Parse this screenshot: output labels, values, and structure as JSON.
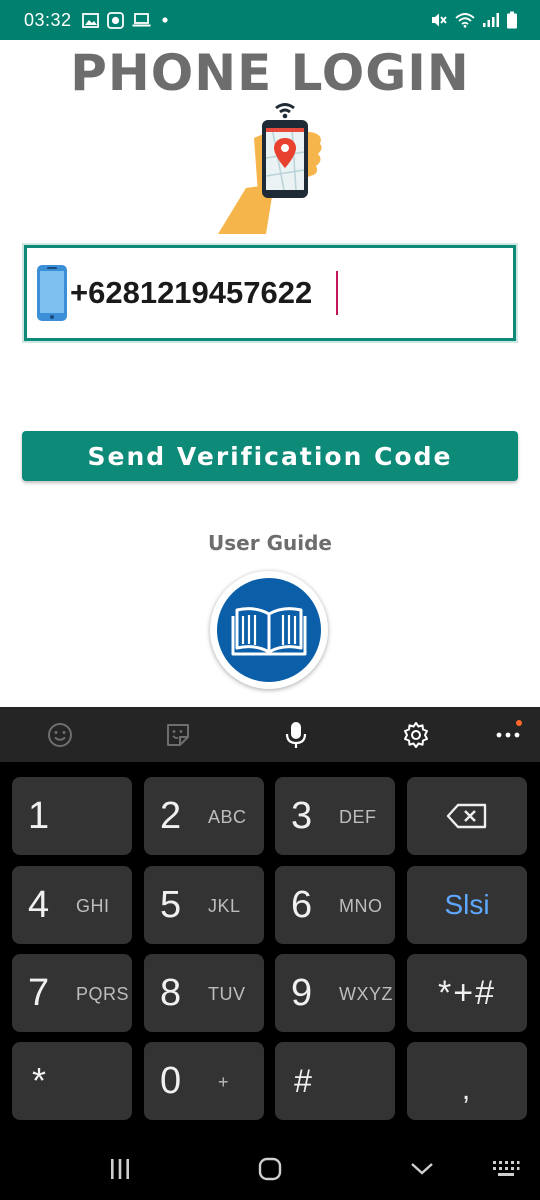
{
  "status_bar": {
    "time": "03:32",
    "left_icons": [
      "image-icon",
      "record-icon",
      "laptop-icon",
      "dot-icon"
    ],
    "right_icons": [
      "mute-icon",
      "wifi-icon",
      "signal-icon",
      "battery-icon"
    ]
  },
  "app": {
    "title": "PHONE LOGIN",
    "hero_icon": "phone-location-hand-icon"
  },
  "phone_field": {
    "value": "+6281219457622",
    "icon": "phone-icon"
  },
  "send_button": {
    "label": "Send Verification Code"
  },
  "user_guide": {
    "label": "User Guide",
    "icon": "book-icon"
  },
  "keyboard_toolbar": {
    "items": [
      "emoji-icon",
      "sticker-icon",
      "microphone-icon",
      "settings-gear-icon",
      "more-dots-icon"
    ]
  },
  "keypad": {
    "keys": [
      {
        "main": "1",
        "sub": ""
      },
      {
        "main": "2",
        "sub": "ABC"
      },
      {
        "main": "3",
        "sub": "DEF"
      },
      {
        "main": "backspace",
        "sub": ""
      },
      {
        "main": "4",
        "sub": "GHI"
      },
      {
        "main": "5",
        "sub": "JKL"
      },
      {
        "main": "6",
        "sub": "MNO"
      },
      {
        "main": "Slsi",
        "sub": ""
      },
      {
        "main": "7",
        "sub": "PQRS"
      },
      {
        "main": "8",
        "sub": "TUV"
      },
      {
        "main": "9",
        "sub": "WXYZ"
      },
      {
        "main": "*+#",
        "sub": ""
      },
      {
        "main": "*",
        "sub": ""
      },
      {
        "main": "0",
        "sub": "+"
      },
      {
        "main": "#",
        "sub": ""
      },
      {
        "main": ",",
        "sub": ""
      }
    ]
  },
  "nav_bar": {
    "items": [
      "recents-icon",
      "home-icon",
      "back-chevron-icon",
      "keyboard-grid-icon"
    ]
  },
  "colors": {
    "accent": "#0e8a78",
    "status_bar": "#00806e",
    "title_gray": "#6d6d6d",
    "guide_blue": "#0a5fa8",
    "keyboard_bg": "#000000",
    "key_bg": "#333333",
    "lang_key_text": "#5ea8ff"
  }
}
